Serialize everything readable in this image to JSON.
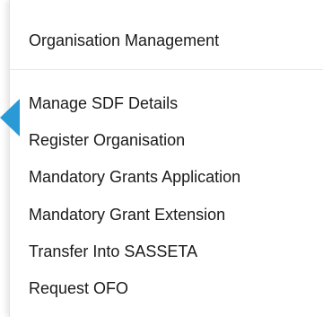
{
  "menu": {
    "header_item": "Organisation Management",
    "items": [
      "Manage SDF Details",
      "Register Organisation",
      "Mandatory Grants Application",
      "Mandatory Grant Extension",
      "Transfer Into SASSETA",
      "Request OFO"
    ]
  },
  "colors": {
    "pointer": "#2a9ad6",
    "text": "#1a1a1a"
  }
}
